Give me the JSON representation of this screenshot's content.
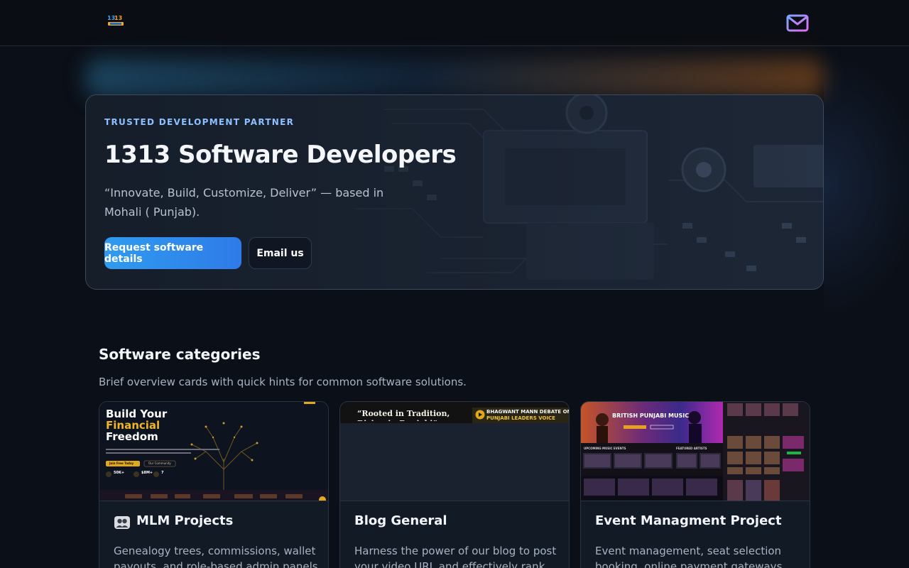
{
  "header": {
    "logo_icon": "brand-logo-icon",
    "mail_icon": "envelope-icon"
  },
  "hero": {
    "eyebrow": "TRUSTED DEVELOPMENT PARTNER",
    "title": "1313 Software Developers",
    "subtitle": "“Innovate, Build, Customize, Deliver” — based in Mohali ( Punjab).",
    "primary_button": "Request software details",
    "secondary_button": "Email us"
  },
  "categories": {
    "title": "Software categories",
    "description": "Brief overview cards with quick hints for common software solutions.",
    "cards": [
      {
        "title": "MLM Projects",
        "icon": "people-icon",
        "desc": "Genealogy trees, commissions, wallet payouts, and role-based admin panels for",
        "image": {
          "headline_1": "Build Your",
          "headline_2": "Financial",
          "headline_3": "Freedom",
          "cta_1": "Join Free Today",
          "cta_2": "Our Community",
          "stat_1": "50K+",
          "stat_2": "$8M+",
          "stat_3": "7"
        }
      },
      {
        "title": "Blog General",
        "desc": "Harness the power of our blog to post your video URL and effectively rank your",
        "image": {
          "quote": "“Rooted in Tradition, Rising in Punjabi”",
          "banner_1": "BHAGWANT MANN DEBATE ON",
          "banner_2": "PUNJABI LEADERS VOICE"
        }
      },
      {
        "title": "Event Managment Project",
        "desc": "Event management, seat selection booking, online payment gateways, user",
        "image": {
          "banner": "BRITISH PUNJABI MUSIC",
          "label_1": "UPCOMING MUSIC EVENTS",
          "label_2": "FEATURED ARTISTS"
        }
      }
    ]
  },
  "colors": {
    "background": "#0b0f17",
    "accent": "#2f8cf0",
    "eyebrow": "#8ec0ff"
  }
}
